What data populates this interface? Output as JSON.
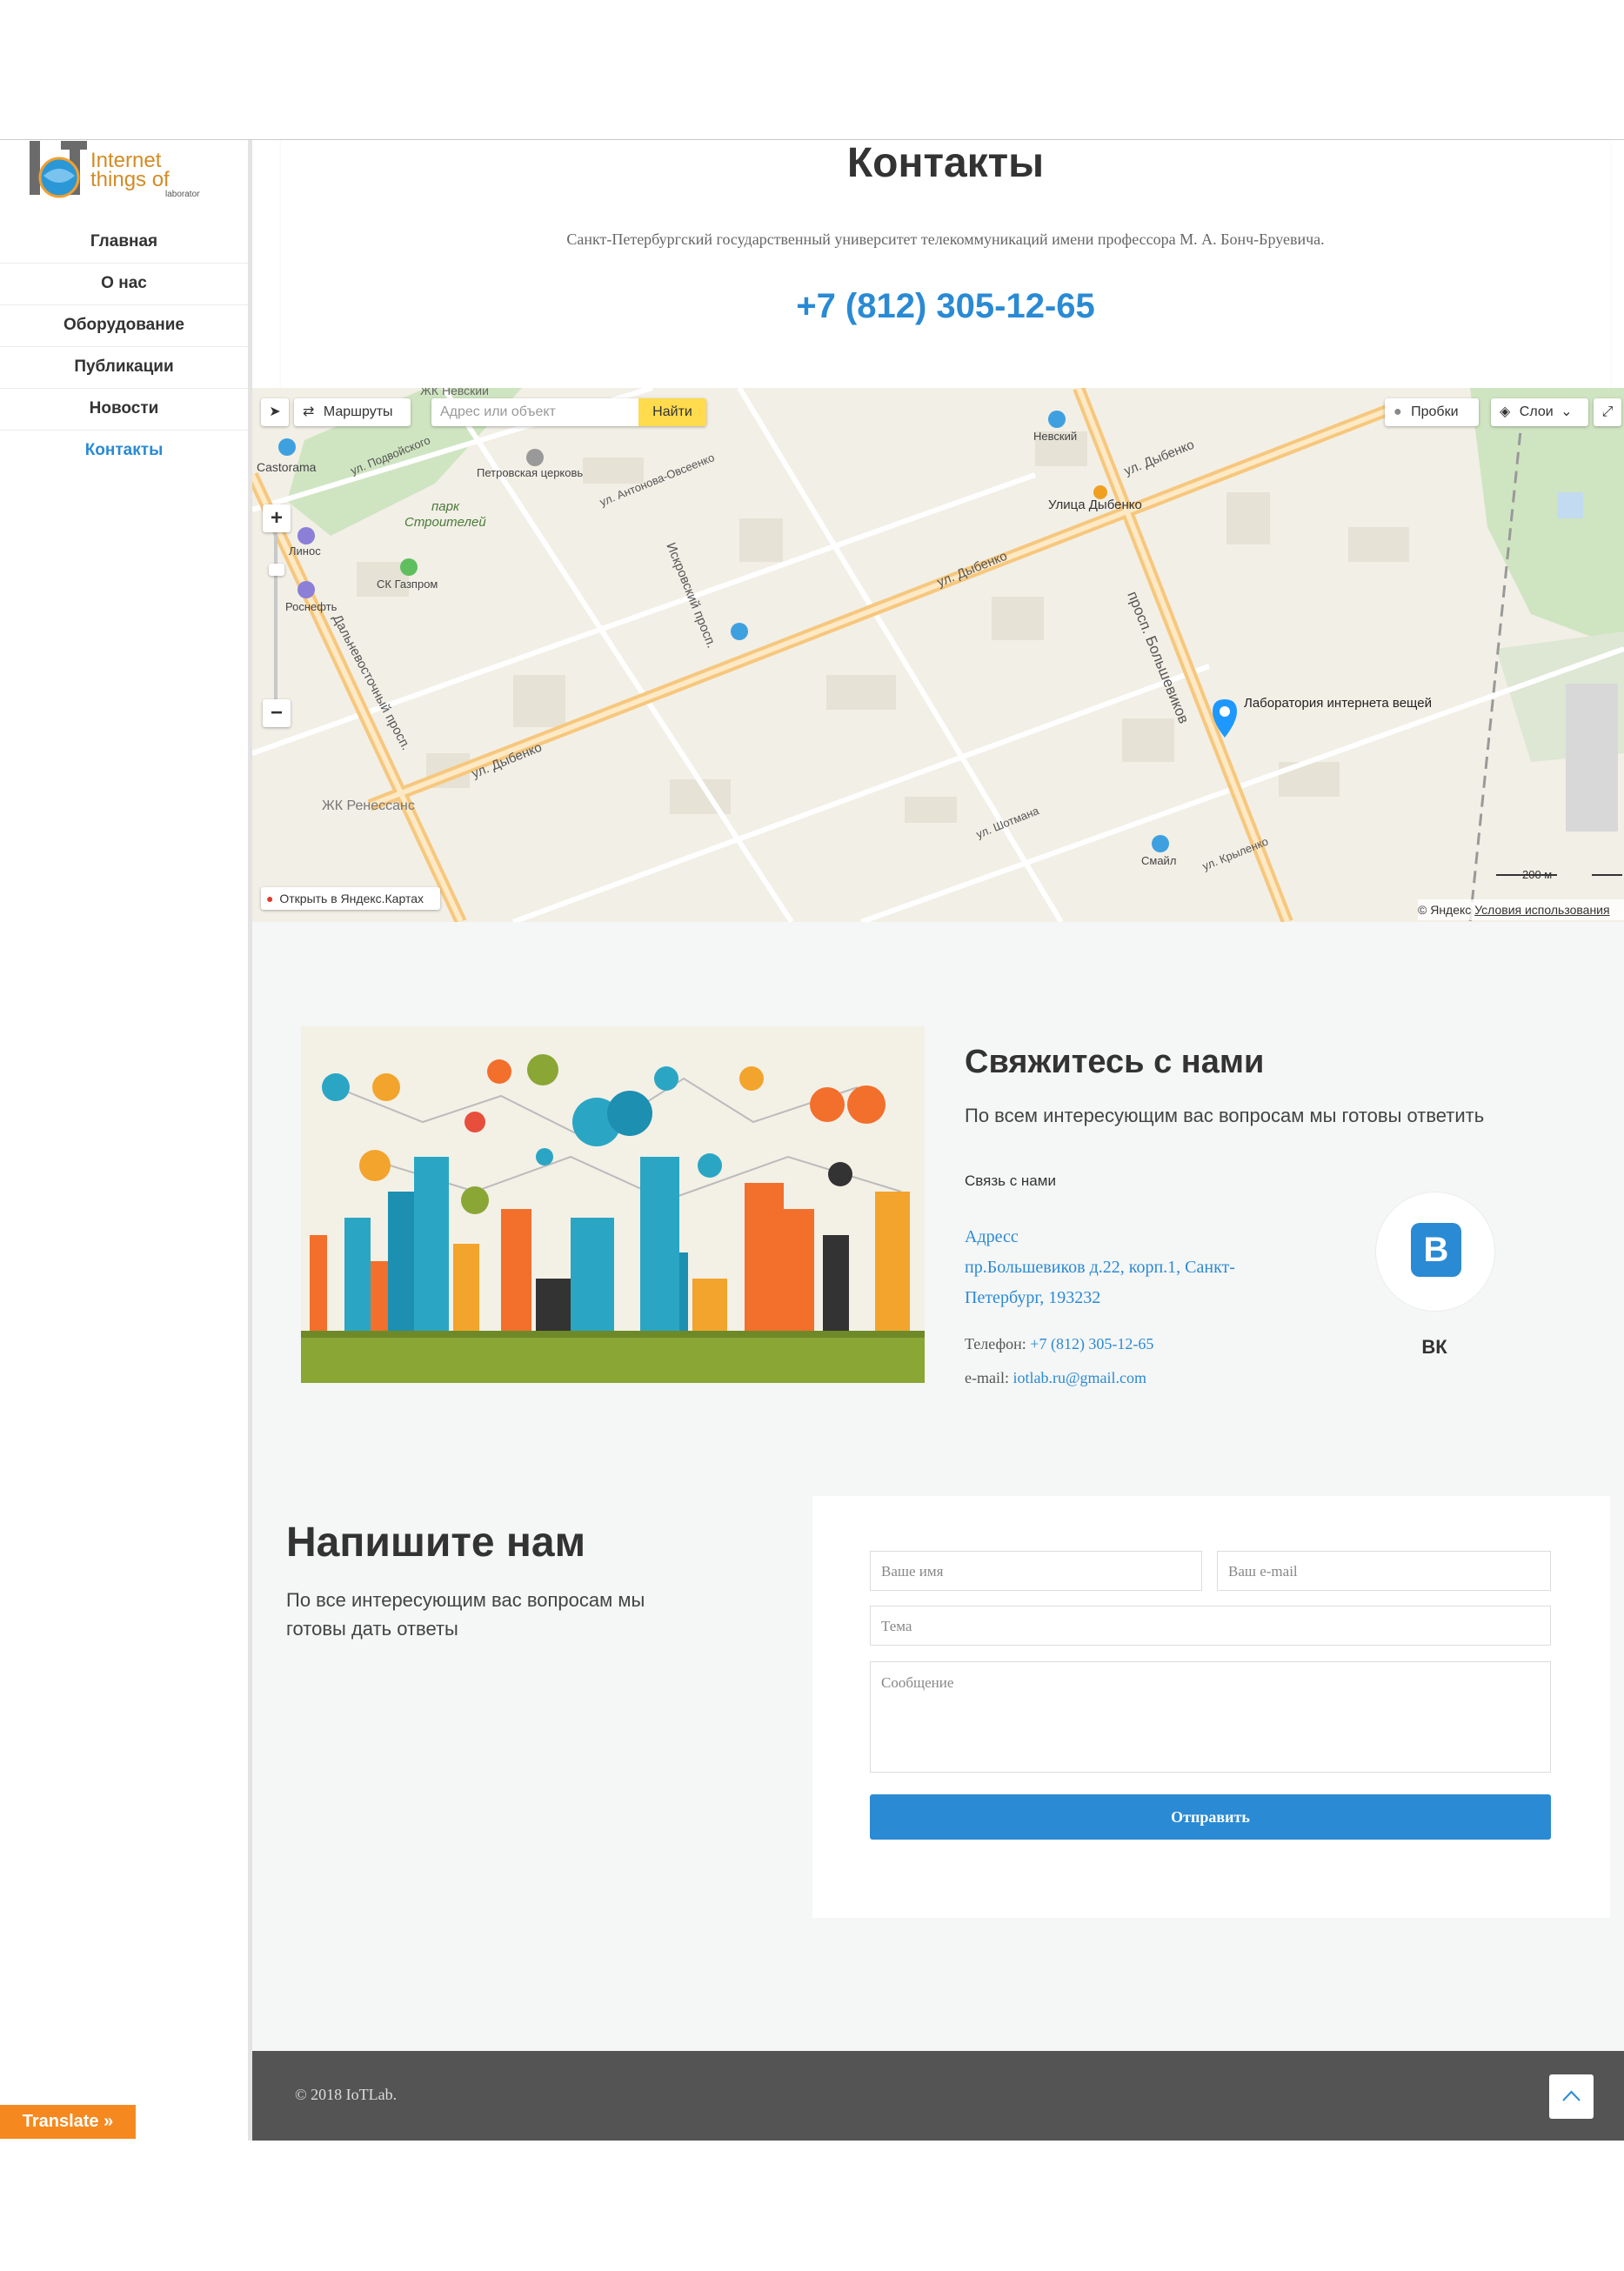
{
  "sidebar": {
    "logo": {
      "text_line1": "Internet",
      "text_line2": "things of",
      "text_line3": "laboratory"
    },
    "items": [
      {
        "label": "Главная"
      },
      {
        "label": "О нас"
      },
      {
        "label": "Оборудование"
      },
      {
        "label": "Публикации"
      },
      {
        "label": "Новости"
      },
      {
        "label": "Контакты",
        "active": true
      }
    ]
  },
  "contacts": {
    "title": "Контакты",
    "university": "Санкт-Петербургский государственный университет телекоммуникаций имени профессора М. А. Бонч-Бруевича.",
    "phone": "+7 (812) 305-12-65"
  },
  "map": {
    "routes_label": "Маршруты",
    "search_placeholder": "Адрес или объект",
    "find_button": "Найти",
    "traffic_label": "Пробки",
    "layers_label": "Слои",
    "open_in_yandex": "Открыть в Яндекс.Картах",
    "scale_label": "200 м",
    "copyright": "© Яндекс",
    "terms": "Условия использования",
    "marker_label": "Лаборатория интернета вещей",
    "labels": {
      "castorama": "Castorama",
      "zhk_nevsky": "ЖК Невский",
      "nevsky": "Невский",
      "podvoyskogo": "ул. Подвойского",
      "church": "Петровская церковь",
      "antonova": "ул. Антонова-Овсеенко",
      "park1": "парк",
      "park2": "Строителей",
      "linos": "Линос",
      "sk_gazprom": "СК Газпром",
      "rosneft": "Роснефть",
      "dybenko_station": "Улица Дыбенко",
      "dybenko1": "ул. Дыбенко",
      "dybenko2": "ул. Дыбенко",
      "dybenko3": "ул. Дыбенко",
      "iskrovsky": "Искровский просп.",
      "bolshevikov": "просп. Большевиков",
      "dalnevostochny": "Дальневосточный просп.",
      "renessans": "ЖК Ренессанс",
      "shotmana": "ул. Шотмана",
      "krylenko": "ул. Крыленко",
      "smile": "Смайл"
    }
  },
  "contact_block": {
    "title": "Свяжитесь с нами",
    "subtitle": "По всем интересующим вас вопросам мы готовы ответить",
    "link_label": "Связь с нами",
    "address_label": "Адресс",
    "address": "пр.Большевиков д.22, корп.1, Санкт-Петербург, 193232",
    "phone_label": "Телефон:",
    "phone": "+7 (812) 305-12-65",
    "email_label": "e-mail:",
    "email": "iotlab.ru@gmail.com",
    "vk_letter": "В",
    "vk_label": "ВК"
  },
  "write_block": {
    "title": "Напишите нам",
    "subtitle": "По все интересующим вас вопросам мы готовы дать ответы",
    "name_placeholder": "Ваше имя",
    "email_placeholder": "Ваш e-mail",
    "subject_placeholder": "Тема",
    "message_placeholder": "Сообщение",
    "submit_label": "Отправить"
  },
  "footer": {
    "copyright": "© 2018 IoTLab."
  },
  "translate_button": "Translate »",
  "colors": {
    "accent": "#2a8ad4",
    "footer": "#545454",
    "translate": "#f5891f"
  }
}
